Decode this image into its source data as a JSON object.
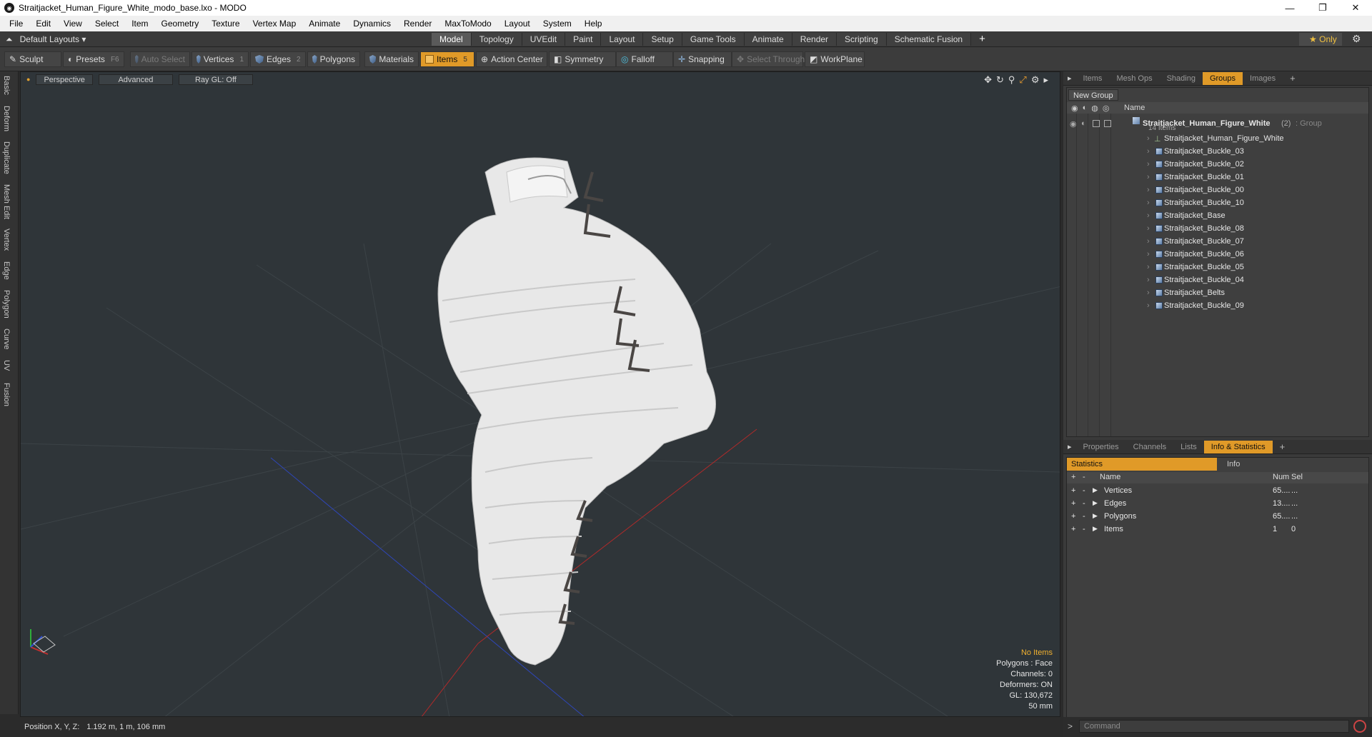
{
  "window": {
    "title": "Straitjacket_Human_Figure_White_modo_base.lxo - MODO",
    "minimize": "—",
    "maximize": "❐",
    "close": "✕"
  },
  "menu": [
    "File",
    "Edit",
    "View",
    "Select",
    "Item",
    "Geometry",
    "Texture",
    "Vertex Map",
    "Animate",
    "Dynamics",
    "Render",
    "MaxToModo",
    "Layout",
    "System",
    "Help"
  ],
  "layouts": {
    "label": "Default Layouts ▾"
  },
  "mode_tabs": [
    "Model",
    "Topology",
    "UVEdit",
    "Paint",
    "Layout",
    "Setup",
    "Game Tools",
    "Animate",
    "Render",
    "Scripting",
    "Schematic Fusion"
  ],
  "mode_active": "Model",
  "only_label": "Only",
  "toolbar": {
    "sculpt": "Sculpt",
    "presets": "Presets",
    "presets_key": "F6",
    "auto_select": "Auto Select",
    "vertices": "Vertices",
    "vertices_key": "1",
    "edges": "Edges",
    "edges_key": "2",
    "polygons": "Polygons",
    "materials": "Materials",
    "items": "Items",
    "items_key": "5",
    "action_center": "Action Center",
    "symmetry": "Symmetry",
    "falloff": "Falloff",
    "snapping": "Snapping",
    "select_through": "Select Through",
    "workplane": "WorkPlane"
  },
  "left_tabs": [
    "Basic",
    "Deform",
    "Duplicate",
    "Mesh Edit",
    "Vertex",
    "Edge",
    "Polygon",
    "Curve",
    "UV",
    "Fusion"
  ],
  "viewport": {
    "perspective": "Perspective",
    "advanced": "Advanced",
    "raygl": "Ray GL: Off",
    "info": {
      "no_items": "No Items",
      "polygons": "Polygons : Face",
      "channels": "Channels: 0",
      "deformers": "Deformers: ON",
      "gl": "GL: 130,672",
      "scale": "50 mm"
    }
  },
  "status": {
    "label": "Position X, Y, Z:",
    "value": "1.192 m, 1 m, 106 mm"
  },
  "top_panel_tabs": [
    "Items",
    "Mesh Ops",
    "Shading",
    "Groups",
    "Images"
  ],
  "top_panel_active": "Groups",
  "groups": {
    "new_group": "New Group",
    "col_name": "Name",
    "root": {
      "name": "Straitjacket_Human_Figure_White",
      "count": "(2)",
      "type": ": Group",
      "sub": "14 Items"
    },
    "items": [
      "Straitjacket_Human_Figure_White",
      "Straitjacket_Buckle_03",
      "Straitjacket_Buckle_02",
      "Straitjacket_Buckle_01",
      "Straitjacket_Buckle_00",
      "Straitjacket_Buckle_10",
      "Straitjacket_Base",
      "Straitjacket_Buckle_08",
      "Straitjacket_Buckle_07",
      "Straitjacket_Buckle_06",
      "Straitjacket_Buckle_05",
      "Straitjacket_Buckle_04",
      "Straitjacket_Belts",
      "Straitjacket_Buckle_09"
    ]
  },
  "bottom_panel_tabs": [
    "Properties",
    "Channels",
    "Lists",
    "Info & Statistics"
  ],
  "bottom_panel_active": "Info & Statistics",
  "stats": {
    "tab_statistics": "Statistics",
    "tab_info": "Info",
    "col_name": "Name",
    "col_num": "Num",
    "col_sel": "Sel",
    "rows": [
      {
        "name": "Vertices",
        "num": "65....",
        "sel": "..."
      },
      {
        "name": "Edges",
        "num": "13....",
        "sel": "..."
      },
      {
        "name": "Polygons",
        "num": "65....",
        "sel": "..."
      },
      {
        "name": "Items",
        "num": "1",
        "sel": "0"
      }
    ]
  },
  "command": {
    "placeholder": "Command"
  }
}
